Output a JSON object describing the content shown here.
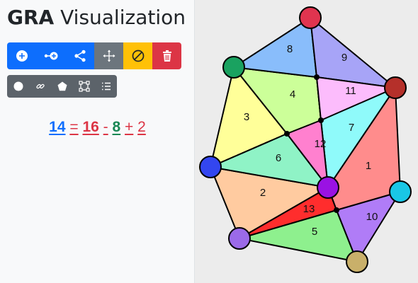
{
  "app": {
    "title_bold": "GRA",
    "title_rest": "Visualization"
  },
  "toolbar_primary": [
    {
      "name": "add-node-button",
      "icon": "plus-circle-icon",
      "color": "#0d6efd"
    },
    {
      "name": "add-edge-button",
      "icon": "connect-node-icon",
      "color": "#0d6efd"
    },
    {
      "name": "share-button",
      "icon": "share-icon",
      "color": "#0d6efd"
    },
    {
      "name": "move-button",
      "icon": "move-arrows-icon",
      "color": "#6c757d"
    },
    {
      "name": "disable-button",
      "icon": "ban-icon",
      "color": "#ffc107"
    },
    {
      "name": "delete-button",
      "icon": "trash-icon",
      "color": "#dc3545"
    }
  ],
  "toolbar_secondary": [
    {
      "name": "show-vertices-toggle",
      "icon": "circle-icon"
    },
    {
      "name": "show-links-toggle",
      "icon": "link-icon"
    },
    {
      "name": "show-faces-toggle",
      "icon": "pentagon-icon"
    },
    {
      "name": "bounding-box-toggle",
      "icon": "bounding-box-icon"
    },
    {
      "name": "list-toggle",
      "icon": "list-icon"
    }
  ],
  "equation": {
    "lhs": "14",
    "eq": "=",
    "a": "16",
    "minus": "-",
    "b": "8",
    "plus": "+",
    "c": "2",
    "colors": {
      "lhs": "#0d6efd",
      "eq": "#dc3545",
      "a": "#dc3545",
      "b": "#198754",
      "ops": "#dc3545"
    }
  },
  "diagram": {
    "nodes": [
      {
        "id": "top",
        "color": "#e0344f"
      },
      {
        "id": "left-top",
        "color": "#1aa260"
      },
      {
        "id": "right-top",
        "color": "#b5302a"
      },
      {
        "id": "left",
        "color": "#3346f0"
      },
      {
        "id": "right",
        "color": "#19c7e6"
      },
      {
        "id": "center",
        "color": "#9a12e3"
      },
      {
        "id": "bottom-left",
        "color": "#9b6ae8"
      },
      {
        "id": "bottom",
        "color": "#c9b06a"
      }
    ],
    "faces": [
      {
        "label": "1",
        "color": "#ff8c8c"
      },
      {
        "label": "2",
        "color": "#ffcba0"
      },
      {
        "label": "3",
        "color": "#ffff99"
      },
      {
        "label": "4",
        "color": "#ccff99"
      },
      {
        "label": "5",
        "color": "#8ef08e"
      },
      {
        "label": "6",
        "color": "#8ff3c6"
      },
      {
        "label": "7",
        "color": "#8ffafa"
      },
      {
        "label": "8",
        "color": "#89bdfb"
      },
      {
        "label": "9",
        "color": "#a7a4f7"
      },
      {
        "label": "10",
        "color": "#b07cf7"
      },
      {
        "label": "11",
        "color": "#fcbcfc"
      },
      {
        "label": "12",
        "color": "#ff80cf"
      },
      {
        "label": "13",
        "color": "#ff2d2d"
      }
    ]
  }
}
